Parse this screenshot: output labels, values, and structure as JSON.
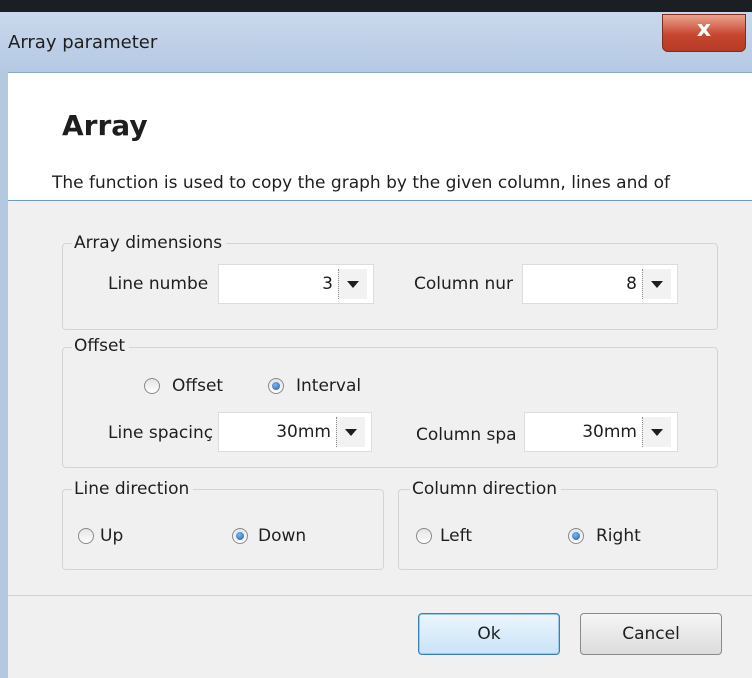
{
  "window": {
    "title": "Array parameter",
    "close_label": "x"
  },
  "header": {
    "title": "Array",
    "description": "The function is used to copy the graph by the given column, lines and of"
  },
  "array_dimensions": {
    "legend": "Array dimensions",
    "line_number_label": "Line numbe",
    "line_number_value": "3",
    "column_number_label": "Column nur",
    "column_number_value": "8"
  },
  "offset": {
    "legend": "Offset",
    "mode_offset_label": "Offset",
    "mode_interval_label": "Interval",
    "mode_selected": "Interval",
    "line_spacing_label": "Line spacinç",
    "line_spacing_value": "30mm",
    "column_spacing_label": "Column spa",
    "column_spacing_value": "30mm"
  },
  "line_direction": {
    "legend": "Line direction",
    "up_label": "Up",
    "down_label": "Down",
    "selected": "Down"
  },
  "column_direction": {
    "legend": "Column direction",
    "left_label": "Left",
    "right_label": "Right",
    "selected": "Right"
  },
  "buttons": {
    "ok_label": "Ok",
    "cancel_label": "Cancel"
  },
  "colors": {
    "accent": "#6f9ad1",
    "close_button": "#c74630",
    "dialog_bg": "#f0f0f0"
  }
}
